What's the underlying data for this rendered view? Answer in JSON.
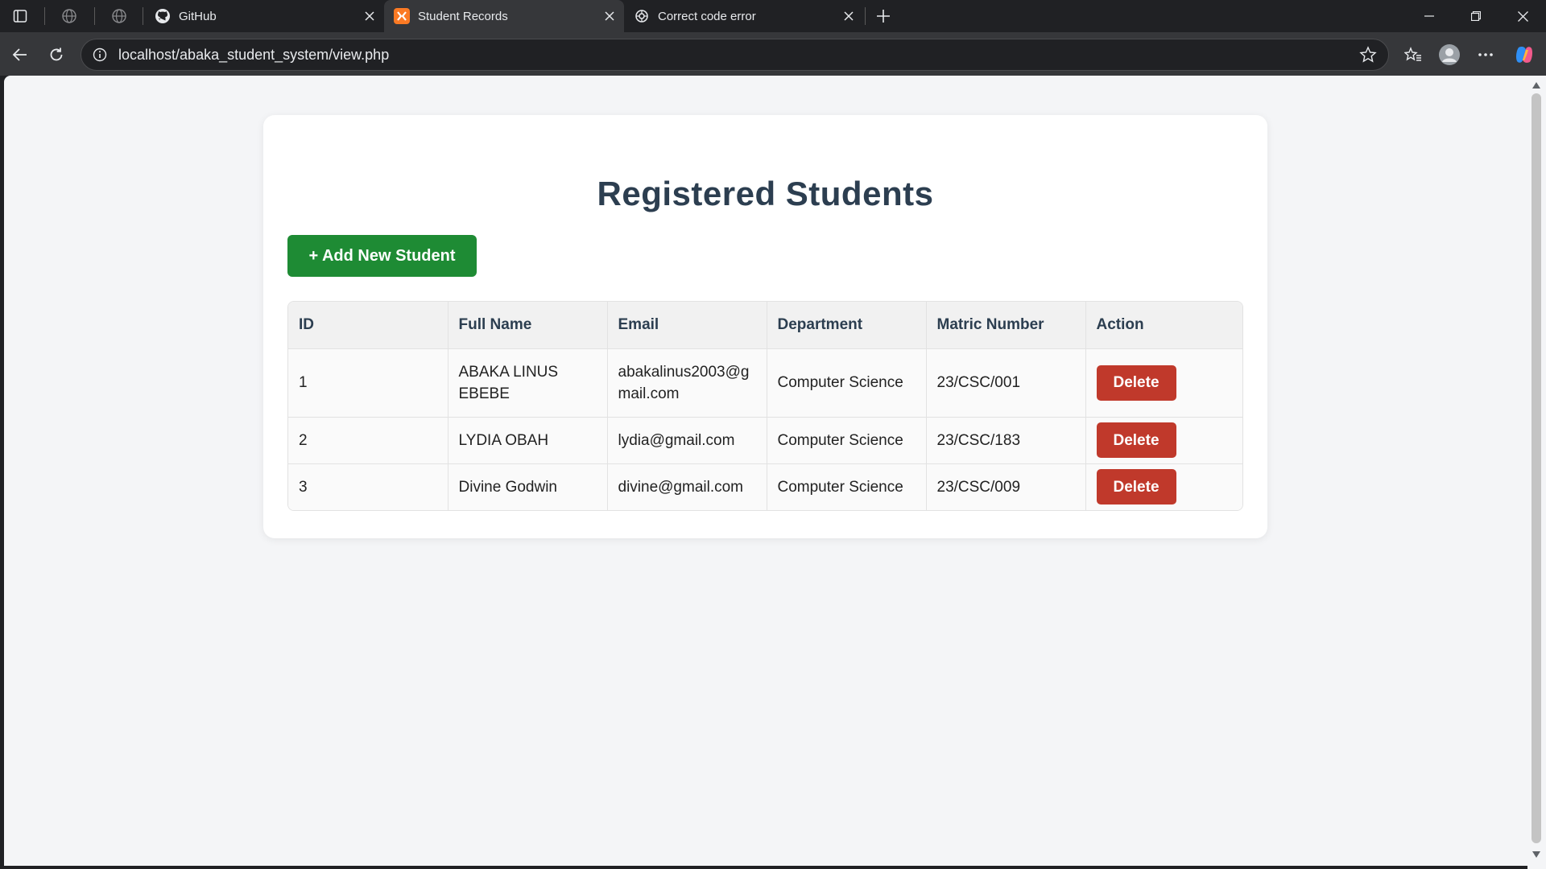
{
  "browser": {
    "tabs": [
      {
        "title": "GitHub",
        "icon": "github-icon",
        "active": false
      },
      {
        "title": "Student Records",
        "icon": "xampp-icon",
        "active": true
      },
      {
        "title": "Correct code error",
        "icon": "chatgpt-icon",
        "active": false
      }
    ],
    "url": "localhost/abaka_student_system/view.php"
  },
  "page": {
    "title": "Registered Students",
    "add_button": "+ Add New Student",
    "columns": [
      "ID",
      "Full Name",
      "Email",
      "Department",
      "Matric Number",
      "Action"
    ],
    "students": [
      {
        "id": "1",
        "name": "ABAKA LINUS EBEBE",
        "email": "abakalinus2003@gmail.com",
        "department": "Computer Science",
        "matric": "23/CSC/001",
        "action": "Delete"
      },
      {
        "id": "2",
        "name": "LYDIA OBAH",
        "email": "lydia@gmail.com",
        "department": "Computer Science",
        "matric": "23/CSC/183",
        "action": "Delete"
      },
      {
        "id": "3",
        "name": "Divine Godwin",
        "email": "divine@gmail.com",
        "department": "Computer Science",
        "matric": "23/CSC/009",
        "action": "Delete"
      }
    ]
  },
  "colors": {
    "title": "#2c3e50",
    "add_button": "#1e8b34",
    "delete_button": "#c0392b",
    "page_background": "#f4f5f7"
  }
}
